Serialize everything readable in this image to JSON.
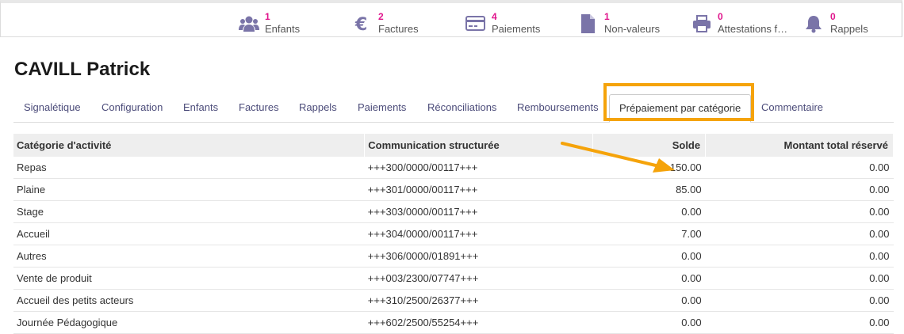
{
  "stats": [
    {
      "count": "1",
      "label": "Enfants",
      "icon": "users-icon"
    },
    {
      "count": "2",
      "label": "Factures",
      "icon": "euro-icon"
    },
    {
      "count": "4",
      "label": "Paiements",
      "icon": "credit-card-icon"
    },
    {
      "count": "1",
      "label": "Non-valeurs",
      "icon": "document-icon"
    },
    {
      "count": "0",
      "label": "Attestations f…",
      "icon": "printer-icon"
    },
    {
      "count": "0",
      "label": "Rappels",
      "icon": "bell-icon"
    }
  ],
  "page_title": "CAVILL Patrick",
  "tabs": [
    "Signalétique",
    "Configuration",
    "Enfants",
    "Factures",
    "Rappels",
    "Paiements",
    "Réconciliations",
    "Remboursements",
    "Prépaiement par catégorie",
    "Commentaire"
  ],
  "active_tab": "Prépaiement par catégorie",
  "table": {
    "headers": [
      "Catégorie d'activité",
      "Communication structurée",
      "Solde",
      "Montant total réservé"
    ],
    "rows": [
      [
        "Repas",
        "+++300/0000/00117+++",
        "150.00",
        "0.00"
      ],
      [
        "Plaine",
        "+++301/0000/00117+++",
        "85.00",
        "0.00"
      ],
      [
        "Stage",
        "+++303/0000/00117+++",
        "0.00",
        "0.00"
      ],
      [
        "Accueil",
        "+++304/0000/00117+++",
        "7.00",
        "0.00"
      ],
      [
        "Autres",
        "+++306/0000/01891+++",
        "0.00",
        "0.00"
      ],
      [
        "Vente de produit",
        "+++003/2300/07747+++",
        "0.00",
        "0.00"
      ],
      [
        "Accueil des petits acteurs",
        "+++310/2500/26377+++",
        "0.00",
        "0.00"
      ],
      [
        "Journée Pédagogique",
        "+++602/2500/55254+++",
        "0.00",
        "0.00"
      ]
    ]
  },
  "colors": {
    "accent_count": "#e0158c",
    "icon": "#7a74a8",
    "highlight": "#f5a30a"
  }
}
